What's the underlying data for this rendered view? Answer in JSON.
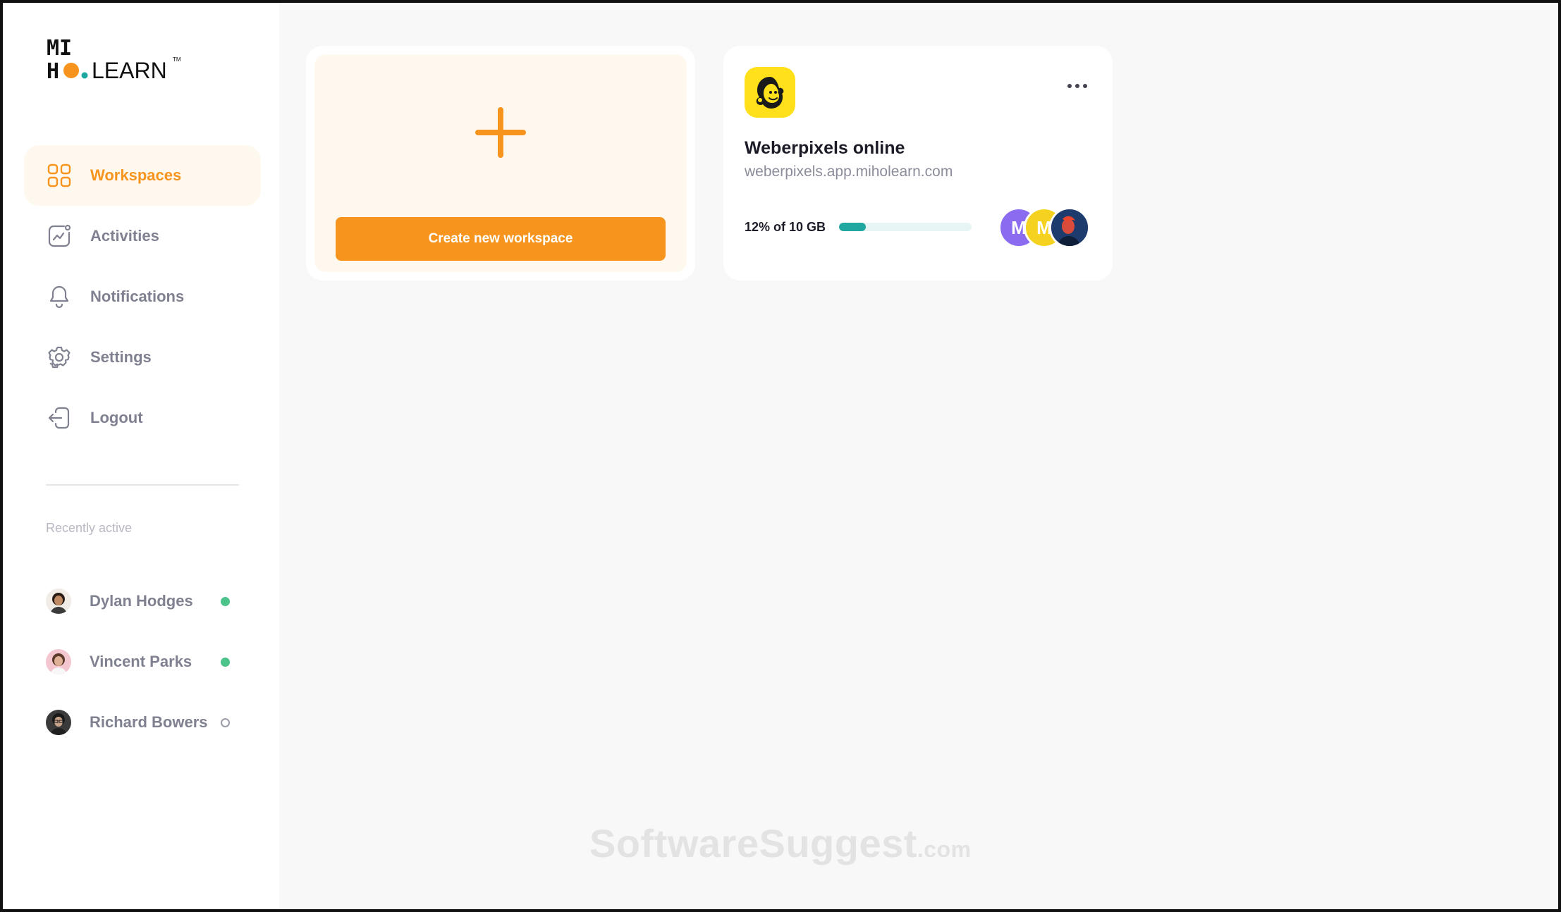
{
  "brand": {
    "logo_line1": "MI",
    "logo_line2": "HO",
    "logo_word": "LEARN",
    "logo_tm": "TM",
    "accent_color": "#f7941d",
    "teal_color": "#1fa89f"
  },
  "sidebar": {
    "nav": [
      {
        "label": "Workspaces",
        "icon": "grid-icon",
        "active": true
      },
      {
        "label": "Activities",
        "icon": "activity-chart-icon",
        "active": false
      },
      {
        "label": "Notifications",
        "icon": "bell-icon",
        "active": false
      },
      {
        "label": "Settings",
        "icon": "gear-icon",
        "active": false
      },
      {
        "label": "Logout",
        "icon": "logout-icon",
        "active": false
      }
    ],
    "recent_title": "Recently active",
    "recent": [
      {
        "name": "Dylan Hodges",
        "status": "online"
      },
      {
        "name": "Vincent Parks",
        "status": "online"
      },
      {
        "name": "Richard Bowers",
        "status": "offline"
      }
    ]
  },
  "main": {
    "create_card": {
      "button_label": "Create new workspace",
      "icon": "plus-icon"
    },
    "workspace_card": {
      "title": "Weberpixels online",
      "url": "weberpixels.app.miholearn.com",
      "usage_text": "12% of 10 GB",
      "usage_fraction": 0.2,
      "logo_icon": "mailchimp-logo-icon",
      "menu_icon": "more-dots-icon",
      "members": [
        {
          "initial": "M",
          "color": "#8b6cf0"
        },
        {
          "initial": "M",
          "color": "#f4d21f"
        },
        {
          "initial": "",
          "color": "#1e3b6e"
        }
      ]
    }
  },
  "watermark": {
    "text": "SoftwareSuggest",
    "suffix": ".com"
  }
}
